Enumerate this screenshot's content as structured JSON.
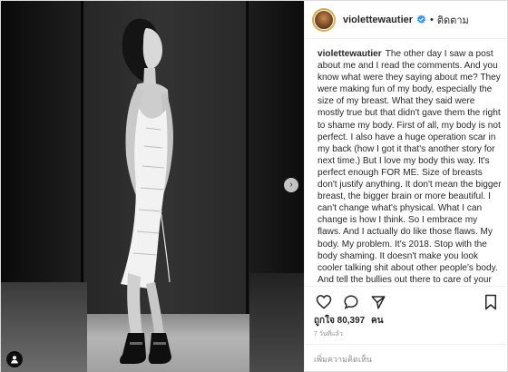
{
  "post": {
    "username": "violettewautier",
    "verified": true,
    "follow_label": "ติดตาม",
    "separator": "•"
  },
  "caption": {
    "username": "violettewautier",
    "text": "The other day I saw a post about me and I read the comments. And you know what were they saying about me? They were making fun of my body, especially the size of my breast. What they said were mostly true but that didn't gave them the right to shame my body. First of all, my body is not perfect. I also have a huge operation scar in my back (how I got it that's another story for next time.) But I love my body this way. It's perfect enough FOR ME. Size of breasts don't justify anything. It don't mean the bigger breast, the bigger brain or more beautiful. I can't change what's physical. What I can change is how I think. So I embrace my flaws. And I actually do like those flaws. My body. My problem. It's 2018. Stop with the body shaming. It doesn't make you look cooler talking shit about other people's body. And tell the bullies out there to care of your own business..."
  },
  "engagement": {
    "likes_prefix": "ถูกใจ",
    "likes_count": "80,397",
    "likes_unit": "คน",
    "timestamp": "7 วันที่แล้ว"
  },
  "comment": {
    "placeholder": "เพิ่มความคิดเห็น"
  },
  "icons": {
    "like": "heart-icon",
    "comment": "comment-bubble-icon",
    "share": "share-icon",
    "save": "bookmark-icon",
    "next": "chevron-right-icon",
    "tag": "person-tag-icon",
    "verified": "verified-badge-icon"
  },
  "colors": {
    "verified_blue": "#3897f0",
    "text": "#262626",
    "muted": "#8e8e8e",
    "border": "#dbdbdb"
  }
}
